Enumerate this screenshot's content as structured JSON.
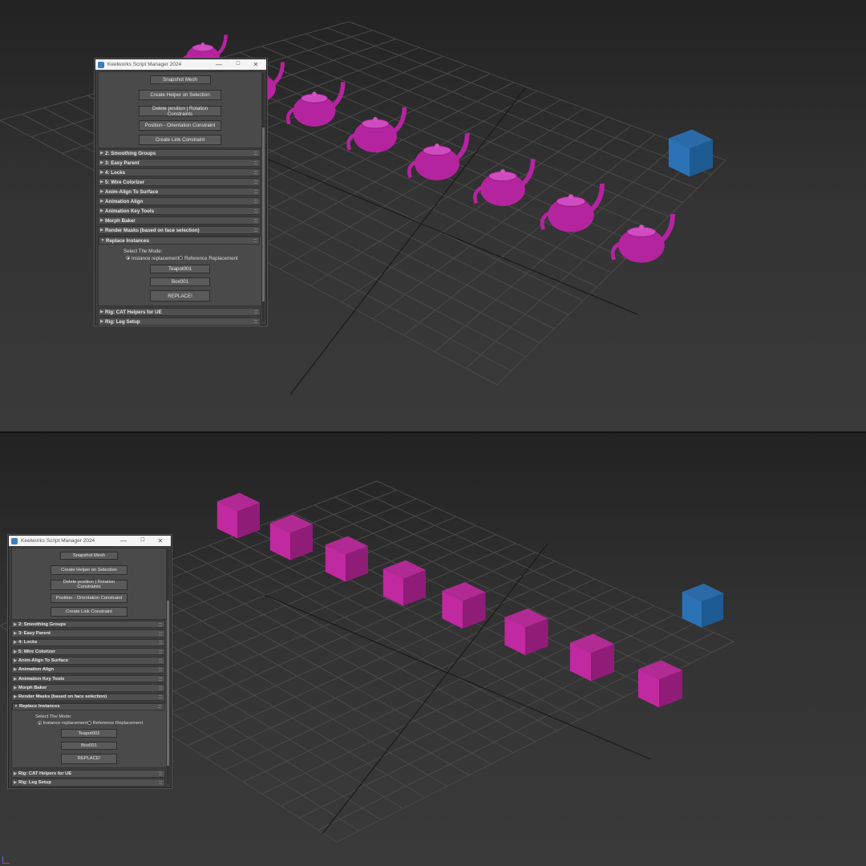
{
  "window": {
    "title": "Keelworks Script Manager 2024",
    "min_glyph": "—",
    "max_glyph": "☐",
    "close_glyph": "✕"
  },
  "tools": {
    "snapshot_mesh": "Snapshot Mesh",
    "create_helper": "Create Helper on Selection",
    "delete_constraints": "Delete position | Rotation Constraints",
    "position_orientation": "Position - Orientation Constraint",
    "create_link": "Create Link Constraint"
  },
  "rollouts_closed": [
    "2: Smoothing Groups",
    "3: Easy Parent",
    "4: Locks",
    "5: Wire Colorizer",
    "Anim-Align To Surface",
    "Animation Align",
    "Animation Key Tools",
    "Morph Baker",
    "Render Masks (based on face selection)"
  ],
  "replace": {
    "title": "Replace Instances",
    "mode_label": "Select The Mode:",
    "option_instance": "Instance replacement",
    "option_reference": "Reference Replacement",
    "source_button": "Teapot001",
    "target_button": "Box001",
    "replace_button": "REPLACE!"
  },
  "rollouts_after": [
    "Rig: CAT Helpers for UE",
    "Rig: Leg Setup"
  ],
  "colors": {
    "teapot": "#b5249f",
    "box_magenta": "#c0299f",
    "box_blue": "#2a72b5",
    "viewport_bg": "#2b2b2b"
  },
  "scene_top": {
    "objects": [
      "teapot",
      "teapot",
      "teapot",
      "teapot",
      "teapot",
      "teapot",
      "teapot",
      "teapot",
      "box"
    ]
  },
  "scene_bottom": {
    "objects": [
      "box",
      "box",
      "box",
      "box",
      "box",
      "box",
      "box",
      "box",
      "box"
    ]
  }
}
